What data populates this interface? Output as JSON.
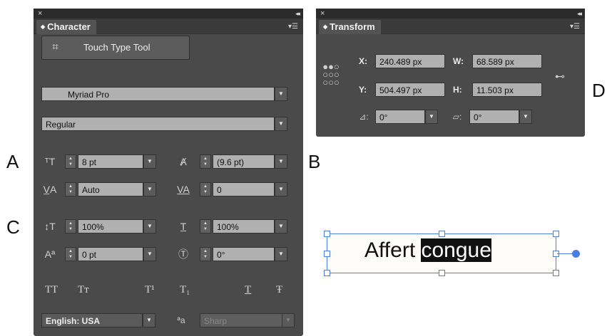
{
  "callouts": {
    "a": "A",
    "b": "B",
    "c": "C",
    "d": "D"
  },
  "character_panel": {
    "tab_title": "Character",
    "touch_type_button": "Touch Type Tool",
    "font_family": "Myriad Pro",
    "font_style": "Regular",
    "font_size": "8 pt",
    "leading": "(9.6 pt)",
    "kerning": "Auto",
    "tracking": "0",
    "vertical_scale": "100%",
    "horizontal_scale": "100%",
    "baseline_shift": "0 pt",
    "character_rotation": "0°",
    "style_buttons": [
      "TT",
      "Tт",
      "T¹",
      "T₁",
      "T",
      "Ŧ"
    ],
    "language": "English: USA",
    "antialias_icon_text": "ªa",
    "antialiasing": "Sharp"
  },
  "transform_panel": {
    "tab_title": "Transform",
    "x_label": "X:",
    "x_value": "240.489 px",
    "y_label": "Y:",
    "y_value": "504.497 px",
    "w_label": "W:",
    "w_value": "68.589 px",
    "h_label": "H:",
    "h_value": "11.503 px",
    "rotate_value": "0°",
    "shear_value": "0°"
  },
  "canvas": {
    "text_normal": "Affert ",
    "text_selected": "congue"
  },
  "colors": {
    "panel_bg": "#4a4a4a",
    "field_bg": "#b0b0b0",
    "selection_blue": "#4a7fe0"
  }
}
